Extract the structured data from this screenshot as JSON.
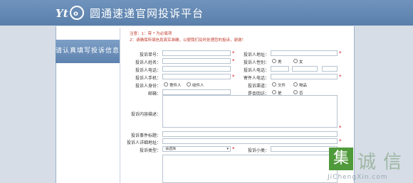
{
  "header": {
    "logo_text": "Yto",
    "site_title": "圆通速递官网投诉平台"
  },
  "sidebar": {
    "tab_label": "请认真填写投诉信息"
  },
  "notice": {
    "line1": "注意：1：带 * 为必填项",
    "line2": "2：请确保所填信息真实准确，以便我们及时处理您的投诉，谢谢！"
  },
  "form": {
    "left_labels": [
      "投诉单号：",
      "投诉人姓名：",
      "投诉人电话：",
      "投诉人手机：",
      "投诉人身份：",
      "邮箱："
    ],
    "right_labels": [
      "投诉人地址：",
      "投诉人性别：",
      "投诉人电话：",
      "寄件人电话：",
      "投诉渠道：",
      "是否回访："
    ],
    "identity": {
      "opt1": "寄件人",
      "opt2": "收件人"
    },
    "gender": {
      "opt1": "男",
      "opt2": "女"
    },
    "channel": {
      "opt1": "文件",
      "opt2": "物品"
    },
    "callback": {
      "opt1": "是",
      "opt2": "否"
    },
    "content_label": "投诉内容描述：",
    "subject_label": "投诉事件标题：",
    "address_label": "投诉人详细地址：",
    "type_label": "投诉类型：",
    "type_value": "请选择",
    "sub_label": "投诉小类："
  },
  "watermark": {
    "chars": [
      "诚",
      "信"
    ],
    "url": "JiChengXin.com"
  },
  "colors": {
    "header": "#6384b3",
    "required": "#d0021b",
    "notice": "#c0392b"
  }
}
